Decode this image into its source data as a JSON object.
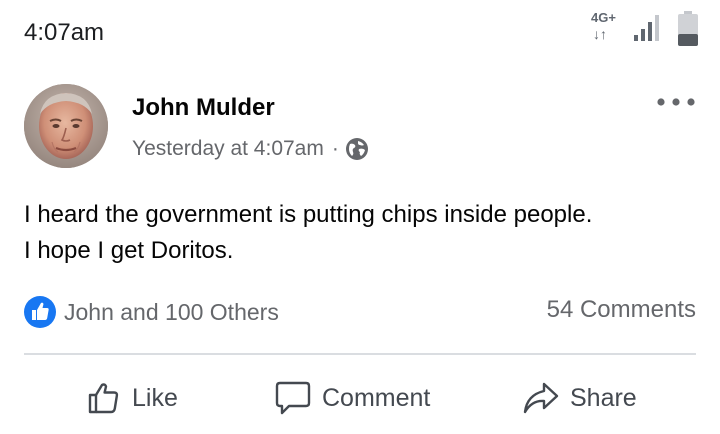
{
  "status_bar": {
    "time": "4:07am",
    "network_label": "4G+",
    "network_arrows": "↓↑"
  },
  "post": {
    "author": "John Mulder",
    "timestamp": "Yesterday at 4:07am",
    "separator": "·",
    "text_lines": [
      "I heard the government is putting chips inside people.",
      "I hope I get Doritos."
    ],
    "reactions_text": "John and 100 Others",
    "comments_text": "54 Comments"
  },
  "actions": {
    "like_label": "Like",
    "comment_label": "Comment",
    "share_label": "Share"
  },
  "colors": {
    "like_blue": "#1877f2",
    "secondary_text": "#65676b",
    "divider": "#dadde1"
  },
  "icons": {
    "globe": "globe-icon",
    "more": "more-options-icon",
    "like": "thumbs-up-icon",
    "comment": "comment-bubble-icon",
    "share": "share-arrow-icon"
  }
}
